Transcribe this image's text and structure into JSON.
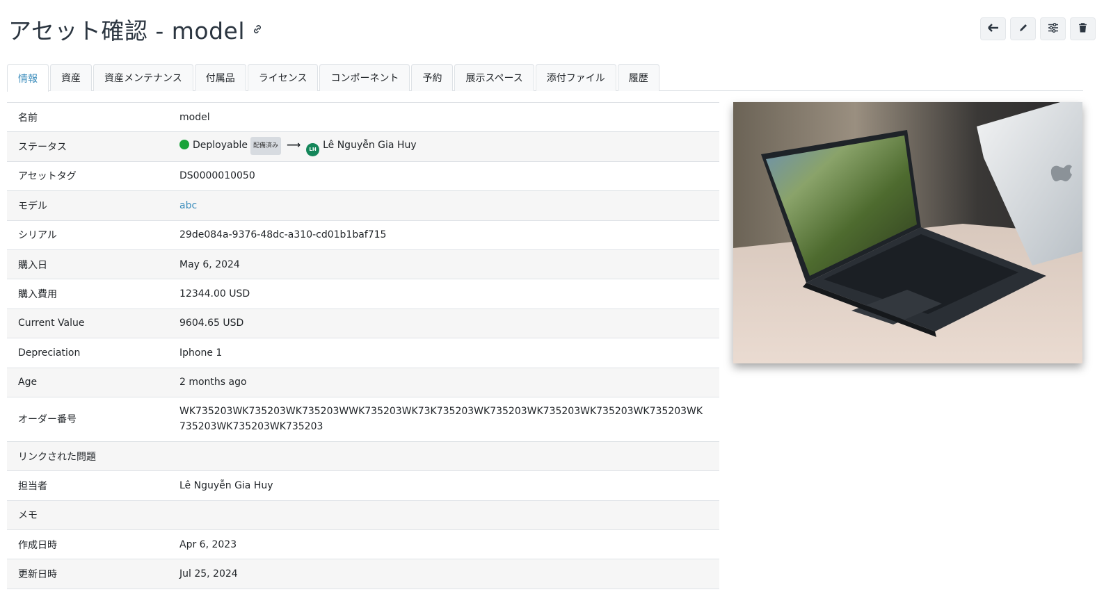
{
  "header": {
    "title": "アセット確認 - model"
  },
  "toolbar": {
    "icons": [
      "back-arrow-icon",
      "pencil-icon",
      "sliders-icon",
      "trash-icon"
    ]
  },
  "tabs": [
    {
      "label": "情報",
      "active": true
    },
    {
      "label": "資産"
    },
    {
      "label": "資産メンテナンス"
    },
    {
      "label": "付属品"
    },
    {
      "label": "ライセンス"
    },
    {
      "label": "コンポーネント"
    },
    {
      "label": "予約"
    },
    {
      "label": "展示スペース"
    },
    {
      "label": "添付ファイル"
    },
    {
      "label": "履歴"
    }
  ],
  "details": {
    "name": {
      "label": "名前",
      "value": "model"
    },
    "status": {
      "label": "ステータス",
      "value": "Deployable",
      "badge": "配備済み",
      "assignee_initials": "LH",
      "assignee": "Lê Nguyễn Gia Huy",
      "status_color": "#1aa33a"
    },
    "asset_tag": {
      "label": "アセットタグ",
      "value": "DS0000010050"
    },
    "model": {
      "label": "モデル",
      "value": "abc"
    },
    "serial": {
      "label": "シリアル",
      "value": "29de084a-9376-48dc-a310-cd01b1baf715"
    },
    "purchase_date": {
      "label": "購入日",
      "value": "May 6, 2024"
    },
    "purchase_cost": {
      "label": "購入費用",
      "value": "12344.00 USD"
    },
    "current_value": {
      "label": "Current Value",
      "value": "9604.65 USD"
    },
    "depreciation": {
      "label": "Depreciation",
      "value": "Iphone 1"
    },
    "age": {
      "label": "Age",
      "value": "2 months ago"
    },
    "order_number": {
      "label": "オーダー番号",
      "value": "WK735203WK735203WK735203WWK735203WK73K735203WK735203WK735203WK735203WK735203WK735203WK735203WK735203"
    },
    "linked_issues": {
      "label": "リンクされた問題",
      "value": ""
    },
    "assigned_to": {
      "label": "担当者",
      "value": "Lê Nguyễn Gia Huy"
    },
    "notes": {
      "label": "メモ",
      "value": ""
    },
    "created_at": {
      "label": "作成日時",
      "value": "Apr 6, 2023"
    },
    "updated_at": {
      "label": "更新日時",
      "value": "Jul 25, 2024"
    }
  },
  "colors": {
    "accent": "#3c8dbc",
    "avatar": "#14865a"
  }
}
